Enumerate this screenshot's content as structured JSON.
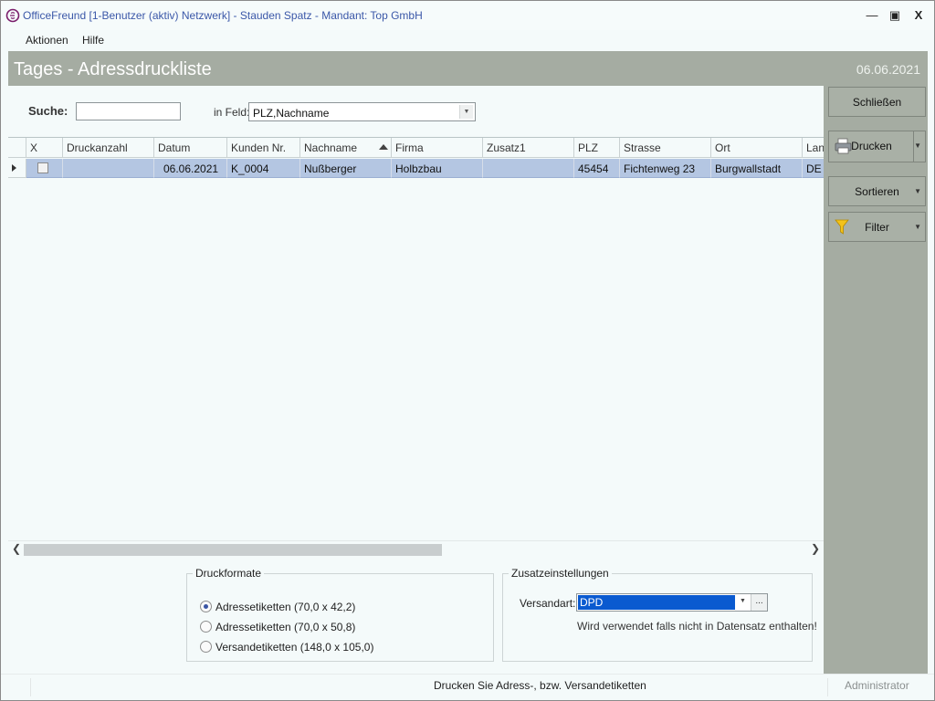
{
  "window": {
    "title": "OfficeFreund [1-Benutzer (aktiv) Netzwerk]  -  Stauden Spatz  -  Mandant: Top GmbH",
    "min_glyph": "🗕",
    "max_glyph": "▣",
    "close_glyph": "X"
  },
  "menu": {
    "items": [
      "Aktionen",
      "Hilfe"
    ]
  },
  "header": {
    "title": "Tages - Adressdruckliste",
    "date": "06.06.2021"
  },
  "search": {
    "label": "Suche:",
    "value": "",
    "field_label": "in Feld:",
    "field_value": "PLZ,Nachname"
  },
  "grid": {
    "columns": [
      "X",
      "Druckanzahl",
      "Datum",
      "Kunden Nr.",
      "Nachname",
      "Firma",
      "Zusatz1",
      "PLZ",
      "Strasse",
      "Ort",
      "Lan"
    ],
    "sorted_column": "Nachname",
    "rows": [
      {
        "x_checked": false,
        "druckanzahl": "",
        "datum": "06.06.2021",
        "kunden_nr": "K_0004",
        "nachname": "Nußberger",
        "firma": "Holbzbau",
        "zusatz1": "",
        "plz": "45454",
        "strasse": "Fichtenweg 23",
        "ort": "Burgwallstadt",
        "land": "DE"
      }
    ]
  },
  "actions": {
    "close": "Schließen",
    "print": "Drucken",
    "sort": "Sortieren",
    "filter": "Filter"
  },
  "druckformate": {
    "title": "Druckformate",
    "options": [
      "Adressetiketten (70,0 x 42,2)",
      "Adressetiketten (70,0 x 50,8)",
      "Versandetiketten (148,0 x 105,0)"
    ],
    "selected_index": 0
  },
  "zusatz": {
    "title": "Zusatzeinstellungen",
    "versandart_label": "Versandart:",
    "versandart_value": "DPD",
    "dots": "...",
    "note": "Wird verwendet falls nicht in Datensatz enthalten!"
  },
  "status": {
    "text": "Drucken Sie Adress-, bzw. Versandetiketten",
    "user": "Administrator"
  },
  "colors": {
    "accent_gray": "#a5aca2",
    "selection": "#b4c6e2",
    "title_blue": "#3a57a8",
    "highlight": "#0a5ad0"
  },
  "icons": [
    "officefreund-logo-icon",
    "minimize-icon",
    "maximize-icon",
    "close-icon",
    "printer-icon",
    "funnel-filter-icon",
    "dropdown-arrow-icon",
    "sort-ascending-icon",
    "row-indicator-icon",
    "scroll-left-icon",
    "scroll-right-icon"
  ]
}
